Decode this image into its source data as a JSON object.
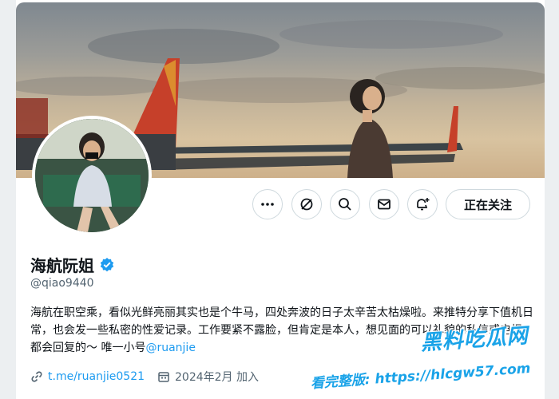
{
  "profile": {
    "display_name": "海航阮姐",
    "handle": "@qiao9440",
    "bio_text": "海航在职空乘，看似光鲜亮丽其实也是个牛马，四处奔波的日子太辛苦太枯燥啦。来推特分享下值机日常，也会发一些私密的性爱记录。工作要紧不露脸，但肯定是本人，想见面的可以礼貌的私信或电报，都会回复的～ 唯一小号",
    "bio_mention": "@ruanjie",
    "link": "t.me/ruanjie0521",
    "joined": "2024年2月 加入",
    "verified": true
  },
  "actions": {
    "more_icon": "more-horizontal-icon",
    "grok_icon": "grok-icon",
    "search_icon": "search-icon",
    "message_icon": "mail-icon",
    "subscribe_icon": "notification-bell-plus-icon",
    "follow_label": "正在关注"
  },
  "watermark": {
    "title": "黑料吃瓜网",
    "url": "看完整版: https://hlcgw57.com"
  },
  "colors": {
    "accent": "#1d9bf0",
    "text": "#0f1419",
    "muted": "#536471",
    "border": "#cfd9de",
    "watermark": "#1aa3e8"
  }
}
